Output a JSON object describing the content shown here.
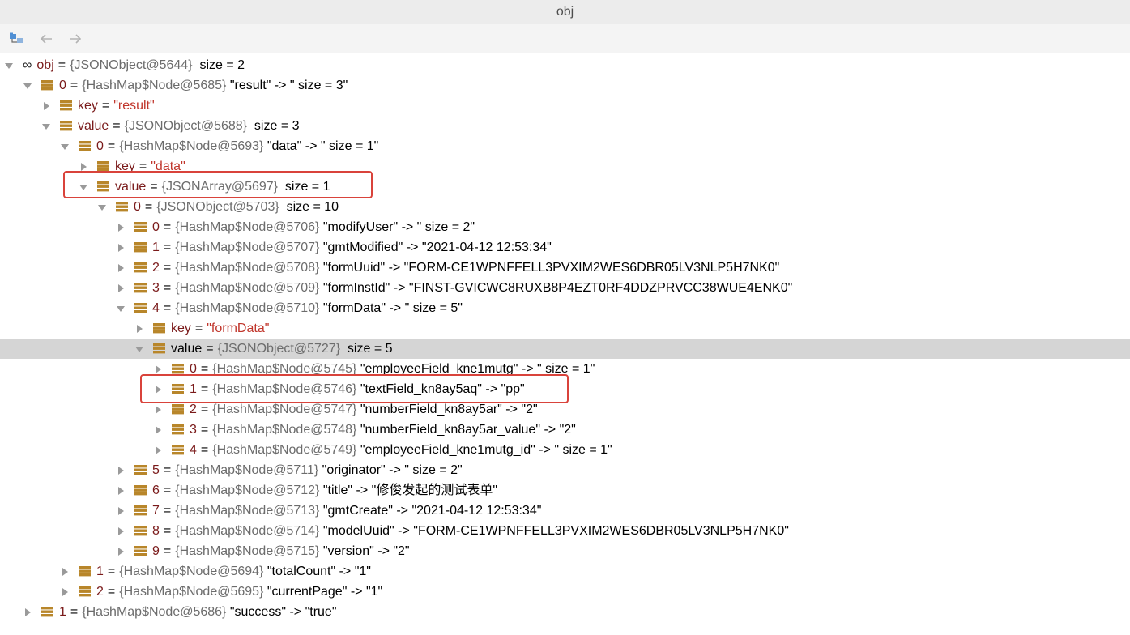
{
  "window": {
    "title": "obj"
  },
  "toolbar": {
    "icons": [
      "folder-tree-icon",
      "back-arrow-icon",
      "forward-arrow-icon"
    ]
  },
  "tree": [
    {
      "depth": 0,
      "arrow": "down",
      "icon": "infinity",
      "name": "obj",
      "type": "{JSONObject@5644}",
      "rest": "  size = 2"
    },
    {
      "depth": 1,
      "arrow": "down",
      "icon": "field",
      "name": "0",
      "type": "{HashMap$Node@5685}",
      "rest": " \"result\" -> \" size = 3\""
    },
    {
      "depth": 2,
      "arrow": "right",
      "icon": "field",
      "name": "key",
      "type": "",
      "rest": "",
      "str": "\"result\""
    },
    {
      "depth": 2,
      "arrow": "down",
      "icon": "field",
      "name": "value",
      "type": "{JSONObject@5688}",
      "rest": "  size = 3"
    },
    {
      "depth": 3,
      "arrow": "down",
      "icon": "field",
      "name": "0",
      "type": "{HashMap$Node@5693}",
      "rest": " \"data\" -> \" size = 1\""
    },
    {
      "depth": 4,
      "arrow": "right",
      "icon": "field",
      "name": "key",
      "type": "",
      "rest": "",
      "str": "\"data\""
    },
    {
      "depth": 4,
      "arrow": "down",
      "icon": "field",
      "name": "value",
      "type": "{JSONArray@5697}",
      "rest": "  size = 1"
    },
    {
      "depth": 5,
      "arrow": "down",
      "icon": "field",
      "name": "0",
      "type": "{JSONObject@5703}",
      "rest": "  size = 10"
    },
    {
      "depth": 6,
      "arrow": "right",
      "icon": "field",
      "name": "0",
      "type": "{HashMap$Node@5706}",
      "rest": " \"modifyUser\" -> \" size = 2\""
    },
    {
      "depth": 6,
      "arrow": "right",
      "icon": "field",
      "name": "1",
      "type": "{HashMap$Node@5707}",
      "rest": " \"gmtModified\" -> \"2021-04-12 12:53:34\""
    },
    {
      "depth": 6,
      "arrow": "right",
      "icon": "field",
      "name": "2",
      "type": "{HashMap$Node@5708}",
      "rest": " \"formUuid\" -> \"FORM-CE1WPNFFELL3PVXIM2WES6DBR05LV3NLP5H7NK0\""
    },
    {
      "depth": 6,
      "arrow": "right",
      "icon": "field",
      "name": "3",
      "type": "{HashMap$Node@5709}",
      "rest": " \"formInstId\" -> \"FINST-GVICWC8RUXB8P4EZT0RF4DDZPRVCC38WUE4ENK0\""
    },
    {
      "depth": 6,
      "arrow": "down",
      "icon": "field",
      "name": "4",
      "type": "{HashMap$Node@5710}",
      "rest": " \"formData\" -> \" size = 5\""
    },
    {
      "depth": 7,
      "arrow": "right",
      "icon": "field",
      "name": "key",
      "type": "",
      "rest": "",
      "str": "\"formData\""
    },
    {
      "depth": 7,
      "arrow": "down",
      "icon": "field",
      "name": "value",
      "type": "{JSONObject@5727}",
      "rest": "  size = 5",
      "selected": true
    },
    {
      "depth": 8,
      "arrow": "right",
      "icon": "field",
      "name": "0",
      "type": "{HashMap$Node@5745}",
      "rest": " \"employeeField_kne1mutg\" -> \" size = 1\""
    },
    {
      "depth": 8,
      "arrow": "right",
      "icon": "field",
      "name": "1",
      "type": "{HashMap$Node@5746}",
      "rest": " \"textField_kn8ay5aq\" -> \"pp\""
    },
    {
      "depth": 8,
      "arrow": "right",
      "icon": "field",
      "name": "2",
      "type": "{HashMap$Node@5747}",
      "rest": " \"numberField_kn8ay5ar\" -> \"2\""
    },
    {
      "depth": 8,
      "arrow": "right",
      "icon": "field",
      "name": "3",
      "type": "{HashMap$Node@5748}",
      "rest": " \"numberField_kn8ay5ar_value\" -> \"2\""
    },
    {
      "depth": 8,
      "arrow": "right",
      "icon": "field",
      "name": "4",
      "type": "{HashMap$Node@5749}",
      "rest": " \"employeeField_kne1mutg_id\" -> \" size = 1\""
    },
    {
      "depth": 6,
      "arrow": "right",
      "icon": "field",
      "name": "5",
      "type": "{HashMap$Node@5711}",
      "rest": " \"originator\" -> \" size = 2\""
    },
    {
      "depth": 6,
      "arrow": "right",
      "icon": "field",
      "name": "6",
      "type": "{HashMap$Node@5712}",
      "rest": " \"title\" -> \"修俊发起的测试表单\""
    },
    {
      "depth": 6,
      "arrow": "right",
      "icon": "field",
      "name": "7",
      "type": "{HashMap$Node@5713}",
      "rest": " \"gmtCreate\" -> \"2021-04-12 12:53:34\""
    },
    {
      "depth": 6,
      "arrow": "right",
      "icon": "field",
      "name": "8",
      "type": "{HashMap$Node@5714}",
      "rest": " \"modelUuid\" -> \"FORM-CE1WPNFFELL3PVXIM2WES6DBR05LV3NLP5H7NK0\""
    },
    {
      "depth": 6,
      "arrow": "right",
      "icon": "field",
      "name": "9",
      "type": "{HashMap$Node@5715}",
      "rest": " \"version\" -> \"2\""
    },
    {
      "depth": 3,
      "arrow": "right",
      "icon": "field",
      "name": "1",
      "type": "{HashMap$Node@5694}",
      "rest": " \"totalCount\" -> \"1\""
    },
    {
      "depth": 3,
      "arrow": "right",
      "icon": "field",
      "name": "2",
      "type": "{HashMap$Node@5695}",
      "rest": " \"currentPage\" -> \"1\""
    },
    {
      "depth": 1,
      "arrow": "right",
      "icon": "field",
      "name": "1",
      "type": "{HashMap$Node@5686}",
      "rest": " \"success\" -> \"true\""
    }
  ],
  "colors": {
    "highlight_border": "#d9433b",
    "selected_row": "#d5d5d5",
    "field_icon": "#b8862a"
  }
}
